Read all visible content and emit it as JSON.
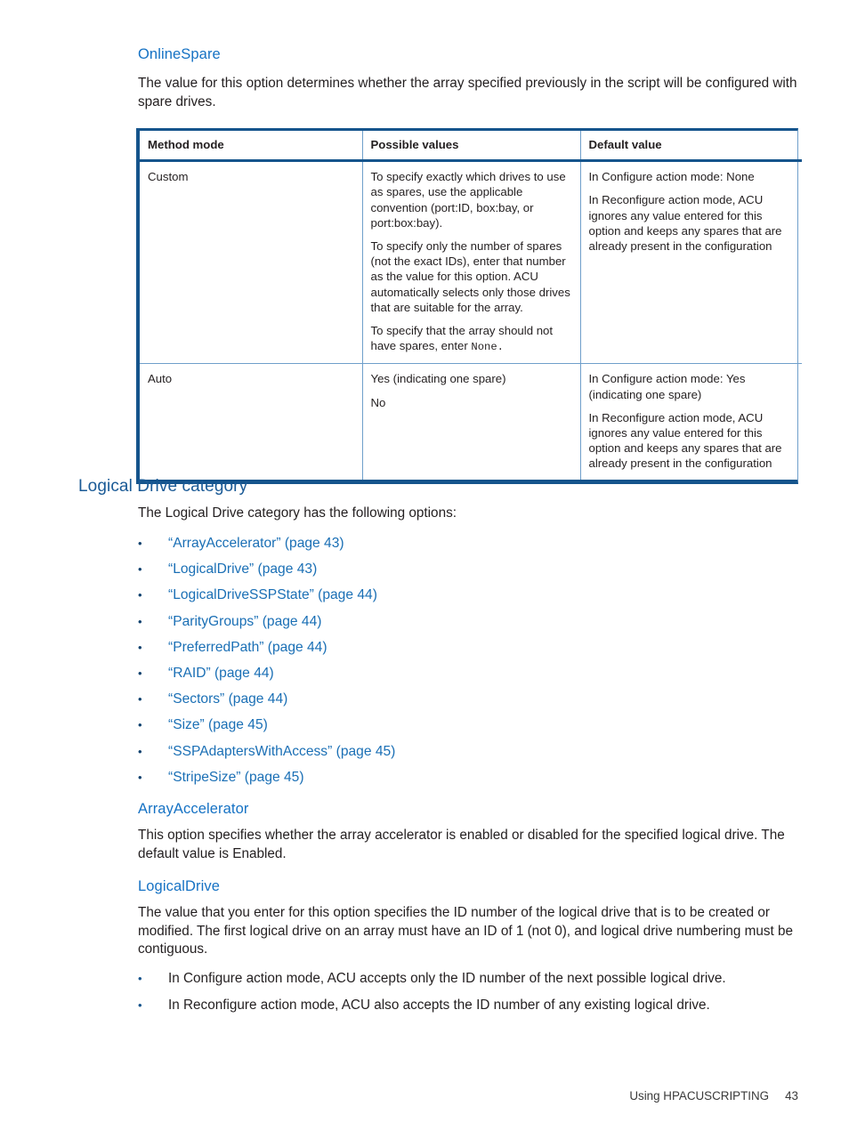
{
  "sections": {
    "online_spare": {
      "heading": "OnlineSpare",
      "intro": "The value for this option determines whether the array specified previously in the script will be configured with spare drives."
    },
    "logical_drive_category": {
      "heading": "Logical Drive category",
      "intro": "The Logical Drive category has the following options:",
      "options": [
        {
          "bullet": "•",
          "label": "“ArrayAccelerator” (page 43)"
        },
        {
          "bullet": "•",
          "label": "“LogicalDrive” (page 43)"
        },
        {
          "bullet": "•",
          "label": "“LogicalDriveSSPState” (page 44)"
        },
        {
          "bullet": "•",
          "label": "“ParityGroups” (page 44)"
        },
        {
          "bullet": "•",
          "label": "“PreferredPath” (page 44)"
        },
        {
          "bullet": "•",
          "label": "“RAID” (page 44)"
        },
        {
          "bullet": "•",
          "label": "“Sectors” (page 44)"
        },
        {
          "bullet": "•",
          "label": "“Size” (page 45)"
        },
        {
          "bullet": "•",
          "label": "“SSPAdaptersWithAccess” (page 45)"
        },
        {
          "bullet": "•",
          "label": "“StripeSize” (page 45)"
        }
      ]
    },
    "array_accelerator": {
      "heading": "ArrayAccelerator",
      "body": "This option specifies whether the array accelerator is enabled or disabled for the specified logical drive. The default value is Enabled."
    },
    "logical_drive": {
      "heading": "LogicalDrive",
      "body": "The value that you enter for this option specifies the ID number of the logical drive that is to be created or modified. The first logical drive on an array must have an ID of 1 (not 0), and logical drive numbering must be contiguous.",
      "bullets": [
        {
          "bullet": "•",
          "text": "In Configure action mode, ACU accepts only the ID number of the next possible logical drive."
        },
        {
          "bullet": "•",
          "text": "In Reconfigure action mode, ACU also accepts the ID number of any existing logical drive."
        }
      ]
    }
  },
  "table": {
    "headers": [
      "Method mode",
      "Possible values",
      "Default value"
    ],
    "rows": [
      {
        "method_mode": "Custom",
        "possible_values": [
          "To specify exactly which drives to use as spares, use the applicable convention (port:ID, box:bay, or port:box:bay).",
          "To specify only the number of spares (not the exact IDs), enter that number as the value for this option. ACU automatically selects only those drives that are suitable for the array.",
          "To specify that the array should not have spares, enter ",
          "None."
        ],
        "default_value": [
          "In Configure action mode: None",
          "In Reconfigure action mode, ACU ignores any value entered for this option and keeps any spares that are already present in the configuration"
        ]
      },
      {
        "method_mode": "Auto",
        "possible_values": [
          "Yes (indicating one spare)",
          "No"
        ],
        "default_value": [
          "In Configure action mode: Yes (indicating one spare)",
          "In Reconfigure action mode, ACU ignores any value entered for this option and keeps any spares that are already present in the configuration"
        ]
      }
    ]
  },
  "footer": {
    "text": "Using HPACUSCRIPTING",
    "page_number": "43"
  },
  "colors": {
    "heading_light_blue": "#1672c4",
    "heading_dark_blue": "#1a5a96",
    "link_blue": "#1a6fb5",
    "table_rule_dark": "#15548c",
    "table_rule_light": "#6f9fcb",
    "body_text": "#231f20"
  }
}
